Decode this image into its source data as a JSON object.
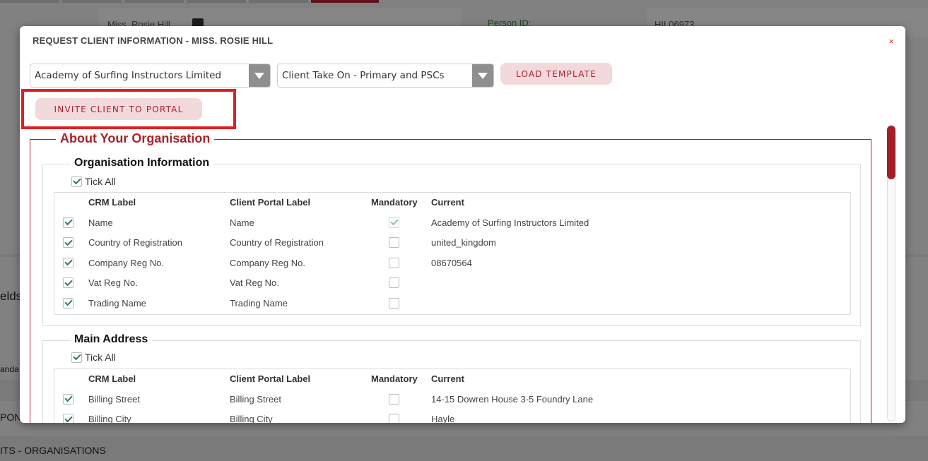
{
  "background": {
    "person_name": "Miss. Rosie Hill",
    "person_id_label": "Person ID:",
    "person_id_value": "HIL06973",
    "side_text_1": "elds",
    "side_text_2": "anda",
    "side_text_3": "PON",
    "bottom_text": "ITS - ORGANISATIONS"
  },
  "modal": {
    "title": "REQUEST CLIENT INFORMATION - MISS. ROSIE HILL",
    "close_label": "×",
    "organisation_select": "Academy of Surfing Instructors Limited",
    "template_select": "Client Take On - Primary and PSCs",
    "load_template_label": "LOAD TEMPLATE",
    "invite_label": "INVITE CLIENT TO PORTAL"
  },
  "about": {
    "legend": "About Your Organisation",
    "columns": {
      "crm": "CRM Label",
      "portal": "Client Portal Label",
      "mandatory": "Mandatory",
      "current": "Current"
    },
    "tick_all_label": "Tick All",
    "sections": [
      {
        "legend": "Organisation Information",
        "rows": [
          {
            "crm": "Name",
            "portal": "Name",
            "mandatory": true,
            "current": "Academy of Surfing Instructors Limited"
          },
          {
            "crm": "Country of Registration",
            "portal": "Country of Registration",
            "mandatory": false,
            "current": "united_kingdom"
          },
          {
            "crm": "Company Reg No.",
            "portal": "Company Reg No.",
            "mandatory": false,
            "current": "08670564"
          },
          {
            "crm": "Vat Reg No.",
            "portal": "Vat Reg No.",
            "mandatory": false,
            "current": ""
          },
          {
            "crm": "Trading Name",
            "portal": "Trading Name",
            "mandatory": false,
            "current": ""
          }
        ]
      },
      {
        "legend": "Main Address",
        "rows": [
          {
            "crm": "Billing Street",
            "portal": "Billing Street",
            "mandatory": false,
            "current": "14-15 Dowren House 3-5 Foundry Lane"
          },
          {
            "crm": "Billing City",
            "portal": "Billing City",
            "mandatory": false,
            "current": "Hayle"
          }
        ]
      }
    ]
  },
  "colors": {
    "brand": "#a8222e",
    "highlight": "#e02020",
    "check": "#2a7d4a"
  }
}
